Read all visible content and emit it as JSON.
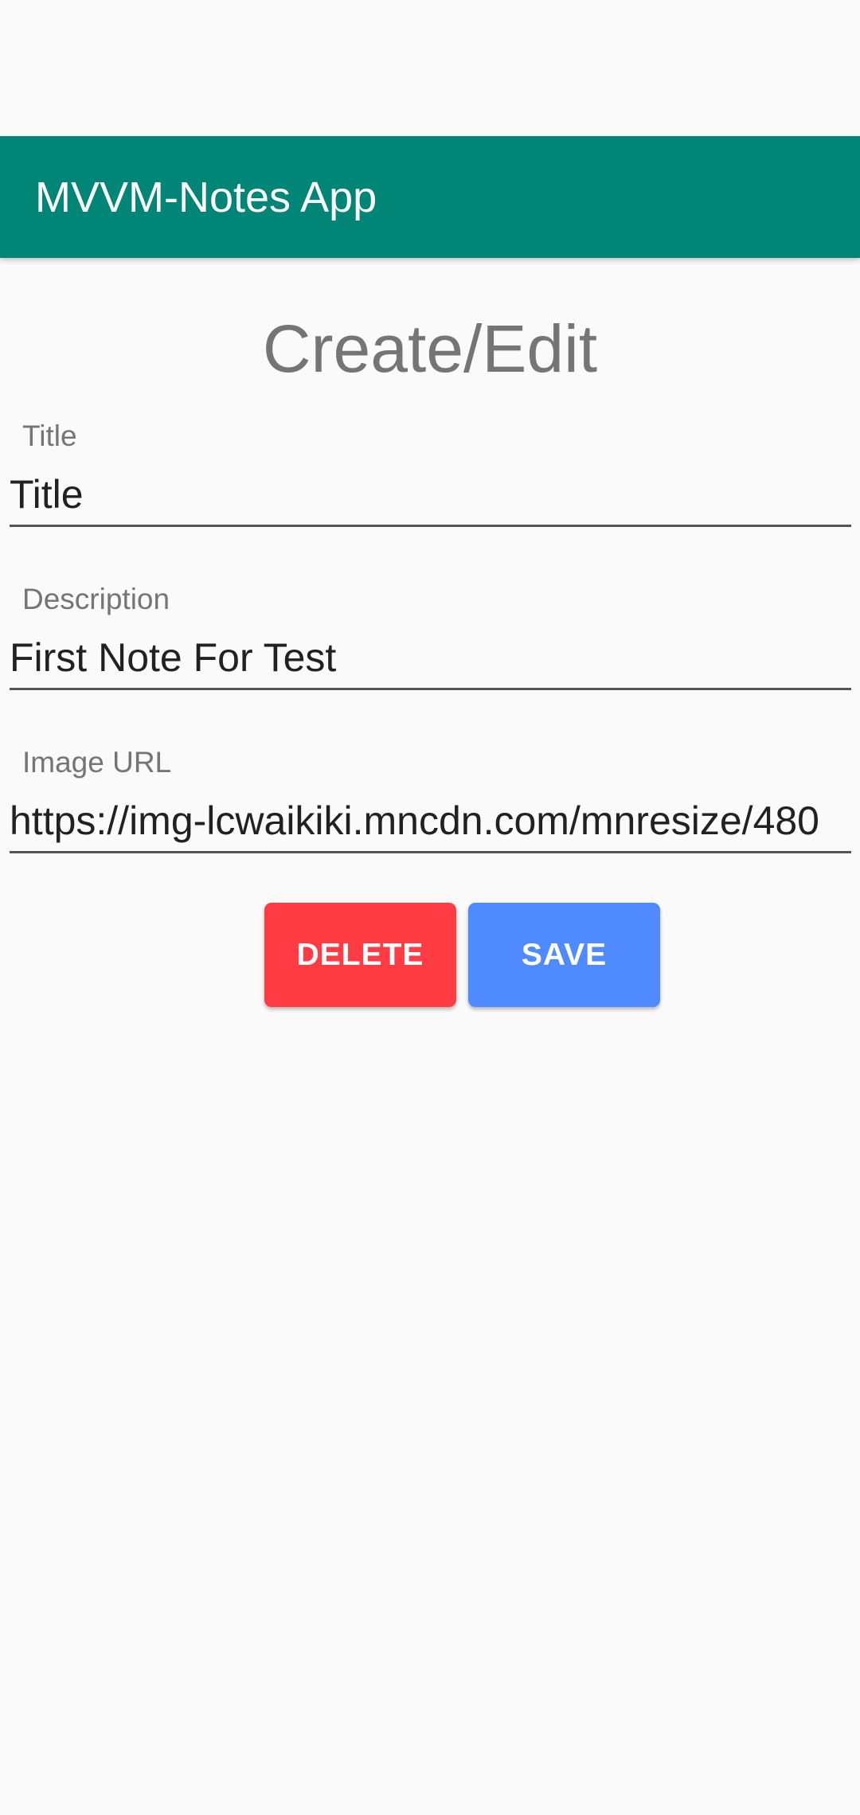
{
  "app": {
    "title": "MVVM-Notes App",
    "header_color": "#008577"
  },
  "page": {
    "heading": "Create/Edit"
  },
  "form": {
    "title": {
      "label": "Title",
      "value": "Title"
    },
    "description": {
      "label": "Description",
      "value": "First Note For Test"
    },
    "image_url": {
      "label": "Image URL",
      "value": "https://img-lcwaikiki.mncdn.com/mnresize/480"
    }
  },
  "actions": {
    "delete_label": "DELETE",
    "delete_color": "#ff3c44",
    "save_label": "SAVE",
    "save_color": "#4f8bff"
  }
}
